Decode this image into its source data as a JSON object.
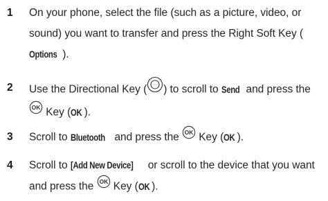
{
  "steps": [
    {
      "number": "1",
      "text_1": "On your phone, select the file (such as a picture, video, or sound) you want to transfer and press the Right Soft Key (",
      "kw_1": "Options",
      "text_2": ")."
    },
    {
      "number": "2",
      "text_1": "Use the Directional Key (",
      "icon_1": "directional-key-icon",
      "text_2": ") to scroll to ",
      "kw_1": "Send",
      "text_3": " and press the ",
      "icon_2": "ok-key-icon",
      "text_4": " Key (",
      "kw_2": "OK",
      "text_5": ")."
    },
    {
      "number": "3",
      "text_1": "Scroll to ",
      "kw_1": "Bluetooth",
      "text_2": " and press the ",
      "icon_1": "ok-key-icon",
      "text_3": " Key (",
      "kw_2": "OK",
      "text_4": ")."
    },
    {
      "number": "4",
      "text_1": "Scroll to ",
      "kw_1": "[Add New Device]",
      "text_2": " or scroll to the device that you want and press the ",
      "icon_1": "ok-key-icon",
      "text_3": " Key (",
      "kw_2": "OK",
      "text_4": ")."
    }
  ],
  "icon_labels": {
    "ok": "OK"
  }
}
